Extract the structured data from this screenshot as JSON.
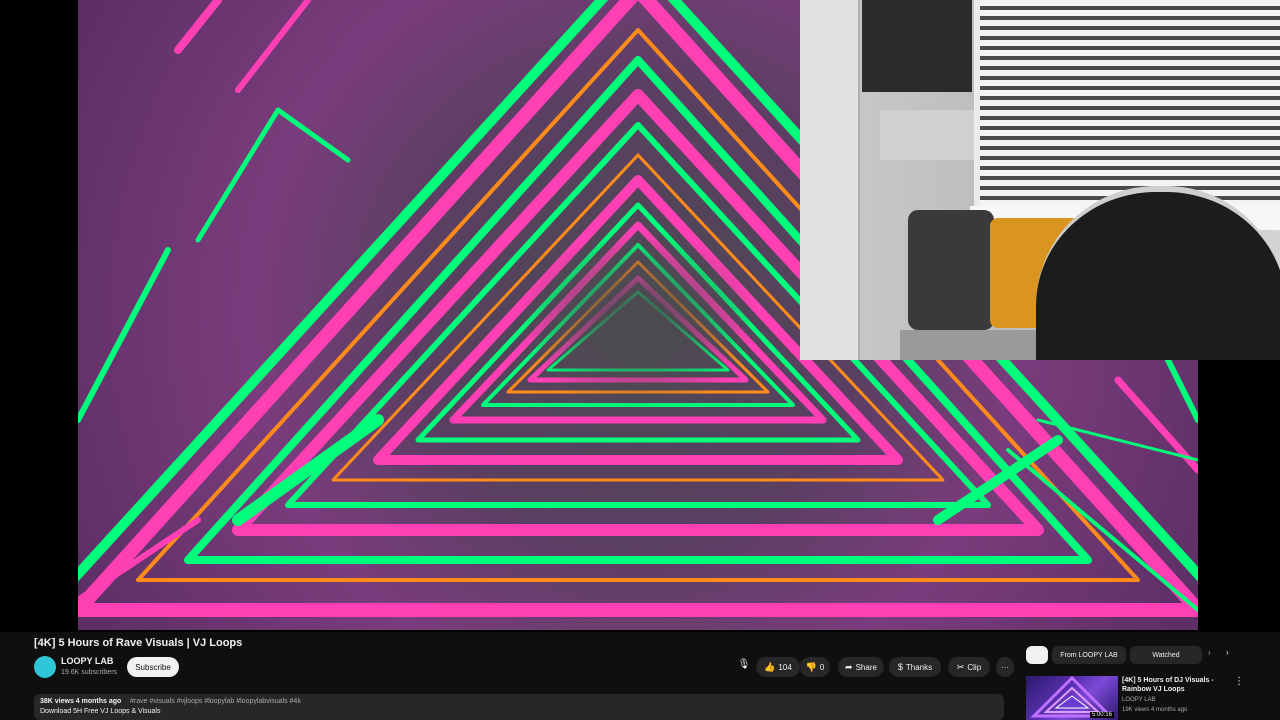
{
  "video": {
    "title": "[4K] 5 Hours of Rave Visuals | VJ Loops",
    "channel": "LOOPY LAB",
    "subscribers": "19.6K subscribers",
    "subscribe_label": "Subscribe"
  },
  "actions": {
    "like_count": "104",
    "dislike_label": "0",
    "share_label": "Share",
    "thanks_label": "Thanks",
    "clip_label": "Clip",
    "more_label": "···",
    "mic_icon": "mic-icon"
  },
  "description": {
    "meta": "38K views  4 months ago",
    "tags": "#rave #visuals #vjloops #loopylab #loopylabvisuals #4k",
    "line2": "Download 5H Free VJ Loops & Visuals"
  },
  "sidebar": {
    "chips": {
      "all": "",
      "from_channel": "From LOOPY LAB",
      "related": "Watched"
    },
    "recommendation": {
      "title": "[4K] 5 Hours of DJ Visuals - Rainbow VJ Loops",
      "channel": "LOOPY LAB",
      "meta": "19K views  4 months ago",
      "duration": "5:00:16"
    }
  },
  "colors": {
    "background": "#0f0f0f",
    "neon_green": "#00ff7a",
    "neon_pink": "#ff3fb4",
    "neon_orange": "#ff8c1a"
  }
}
